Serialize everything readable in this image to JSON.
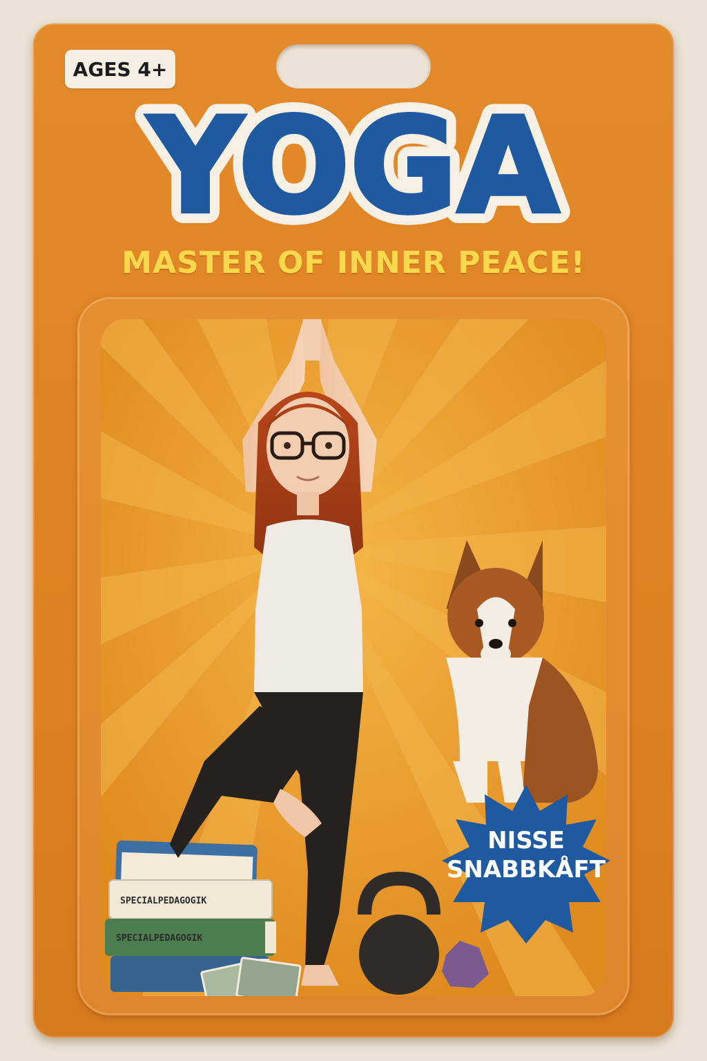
{
  "package": {
    "age_badge": "AGES 4+",
    "title": "YOGA",
    "subtitle": "MASTER OF INNER PEACE!",
    "sticker_line1": "NISSE",
    "sticker_line2": "SNABBKÅFT",
    "book_label_1": "SPECIALPEDAGOGIK",
    "book_label_2": "SPECIALPEDAGOGIK"
  },
  "colors": {
    "card_orange": "#e38a2a",
    "title_blue": "#1f5aa0",
    "title_outline": "#f6efe3",
    "subtitle_yellow": "#f9d84e",
    "sticker_blue": "#1f5aa0"
  }
}
